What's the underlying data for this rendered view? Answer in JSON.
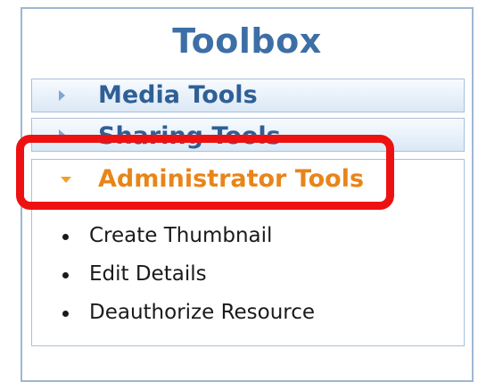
{
  "toolbox": {
    "title": "Toolbox",
    "sections": {
      "media": {
        "label": "Media Tools",
        "expanded": false
      },
      "sharing": {
        "label": "Sharing Tools",
        "expanded": false
      },
      "admin": {
        "label": "Administrator Tools",
        "expanded": true,
        "items": [
          "Create Thumbnail",
          "Edit Details",
          "Deauthorize Resource"
        ]
      }
    }
  },
  "colors": {
    "title": "#3d6fa6",
    "section_label": "#2f5f95",
    "active_label": "#e8851a",
    "highlight": "#ee1111"
  }
}
